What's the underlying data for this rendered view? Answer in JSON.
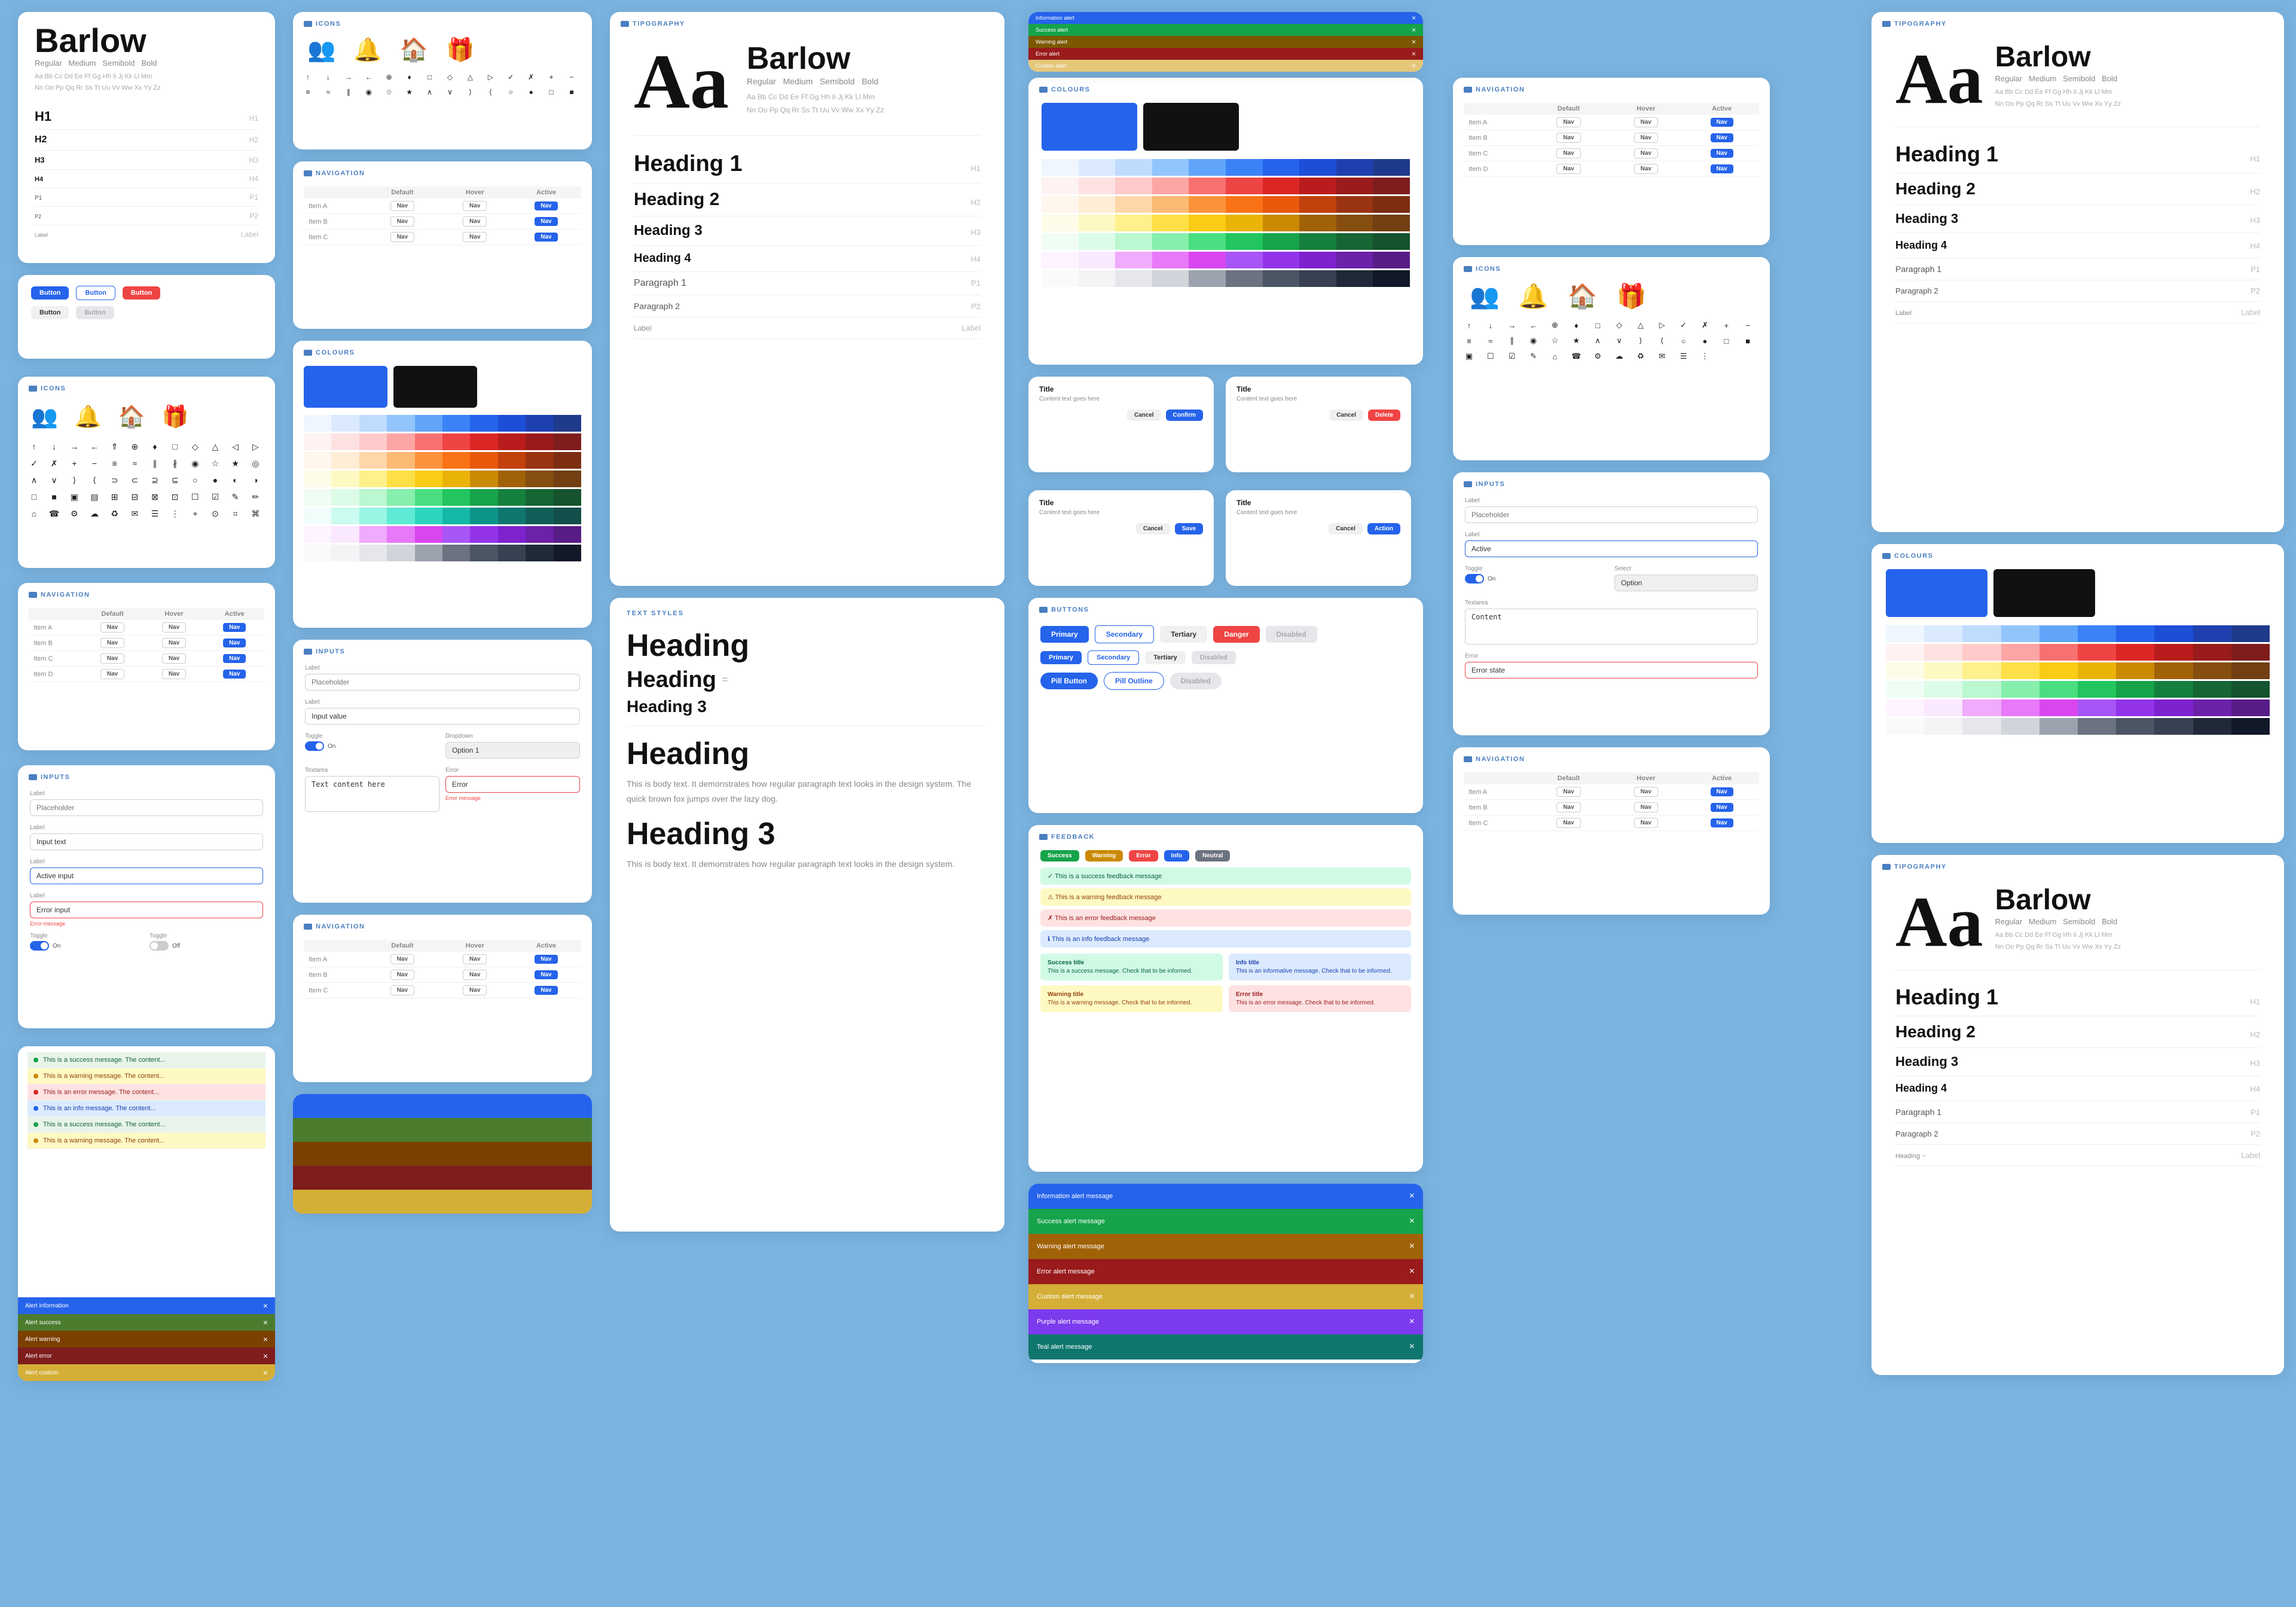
{
  "bg": "#7ab3e0",
  "cards": {
    "typography_main": {
      "label": "TYPOGRAPHY",
      "font_name": "Barlow",
      "aa": "Aa",
      "weights": "Regular  Medium  Semibold  Bold",
      "alphabet": "Aa Bb Cc Dd Ee Ff Gg Hh Ii Jj Kk Ll Mm Nn Oo Pp Qq Rr Ss Tt Uu Vv Ww Xx Yy Zz",
      "headings": [
        {
          "label": "Heading 1",
          "tag": "H1",
          "size": "38px"
        },
        {
          "label": "Heading 2",
          "tag": "H2",
          "size": "30px"
        },
        {
          "label": "Heading 3",
          "tag": "H3",
          "size": "24px"
        },
        {
          "label": "Heading 4",
          "tag": "H4",
          "size": "20px"
        },
        {
          "label": "Paragraph 1",
          "tag": "P1",
          "size": "16px"
        },
        {
          "label": "Paragraph 2",
          "tag": "P2",
          "size": "14px"
        },
        {
          "label": "Label",
          "tag": "Label",
          "size": "12px"
        }
      ]
    },
    "colours_label": "COLOURS",
    "icons_label": "ICONS",
    "navigation_label": "NAVIGATION",
    "inputs_label": "INPUTS",
    "buttons_label": "BUTTONS",
    "feedback_label": "FEEDBACK",
    "text_styles_label": "TEXT STYLES",
    "heading_labels": [
      "Heading",
      "Heading =",
      "Heading 3",
      "Heading 2",
      "Heading",
      "Heading 3",
      "Heading ~"
    ]
  }
}
